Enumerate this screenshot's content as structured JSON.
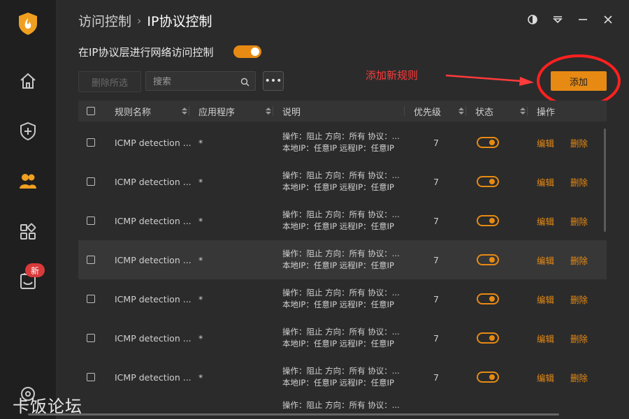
{
  "breadcrumb": {
    "parent": "访问控制",
    "separator": "›",
    "current": "IP协议控制"
  },
  "window_controls": [
    "theme-icon",
    "dropdown-icon",
    "minimize-icon",
    "close-icon"
  ],
  "toggle_label": "在IP协议层进行网络访问控制",
  "toggle_on": true,
  "toolbar": {
    "delete_label": "删除所选",
    "search_placeholder": "搜索",
    "more_label": "•••",
    "add_label": "添加"
  },
  "annotation": {
    "text": "添加新规则",
    "color": "#ff3b3b"
  },
  "sidebar": {
    "new_badge": "新"
  },
  "columns": [
    "规则名称",
    "应用程序",
    "说明",
    "优先级",
    "状态",
    "操作"
  ],
  "rows": [
    {
      "name": "ICMP detection ...",
      "app": "*",
      "desc1": "操作：阻止 方向：所有 协议：...",
      "desc2": "本地IP：任意IP 远程IP：任意IP",
      "priority": "7",
      "edit": "编辑",
      "delete": "删除"
    },
    {
      "name": "ICMP detection ...",
      "app": "*",
      "desc1": "操作：阻止 方向：所有 协议：...",
      "desc2": "本地IP：任意IP 远程IP：任意IP",
      "priority": "7",
      "edit": "编辑",
      "delete": "删除"
    },
    {
      "name": "ICMP detection ...",
      "app": "*",
      "desc1": "操作：阻止 方向：所有 协议：...",
      "desc2": "本地IP：任意IP 远程IP：任意IP",
      "priority": "7",
      "edit": "编辑",
      "delete": "删除"
    },
    {
      "name": "ICMP detection ...",
      "app": "*",
      "desc1": "操作：阻止 方向：所有 协议：...",
      "desc2": "本地IP：任意IP 远程IP：任意IP",
      "priority": "7",
      "edit": "编辑",
      "delete": "删除"
    },
    {
      "name": "ICMP detection ...",
      "app": "*",
      "desc1": "操作：阻止 方向：所有 协议：...",
      "desc2": "本地IP：任意IP 远程IP：任意IP",
      "priority": "7",
      "edit": "编辑",
      "delete": "删除"
    },
    {
      "name": "ICMP detection ...",
      "app": "*",
      "desc1": "操作：阻止 方向：所有 协议：...",
      "desc2": "本地IP：任意IP 远程IP：任意IP",
      "priority": "7",
      "edit": "编辑",
      "delete": "删除"
    },
    {
      "name": "ICMP detection ...",
      "app": "*",
      "desc1": "操作：阻止 方向：所有 协议：...",
      "desc2": "本地IP：任意IP 远程IP：任意IP",
      "priority": "7",
      "edit": "编辑",
      "delete": "删除"
    },
    {
      "name": "",
      "app": "",
      "desc1": "操作：阻止 方向：所有 协议：...",
      "desc2": "",
      "priority": "",
      "edit": "",
      "delete": ""
    }
  ],
  "watermark": "卡饭论坛",
  "accent": "#e78a13"
}
